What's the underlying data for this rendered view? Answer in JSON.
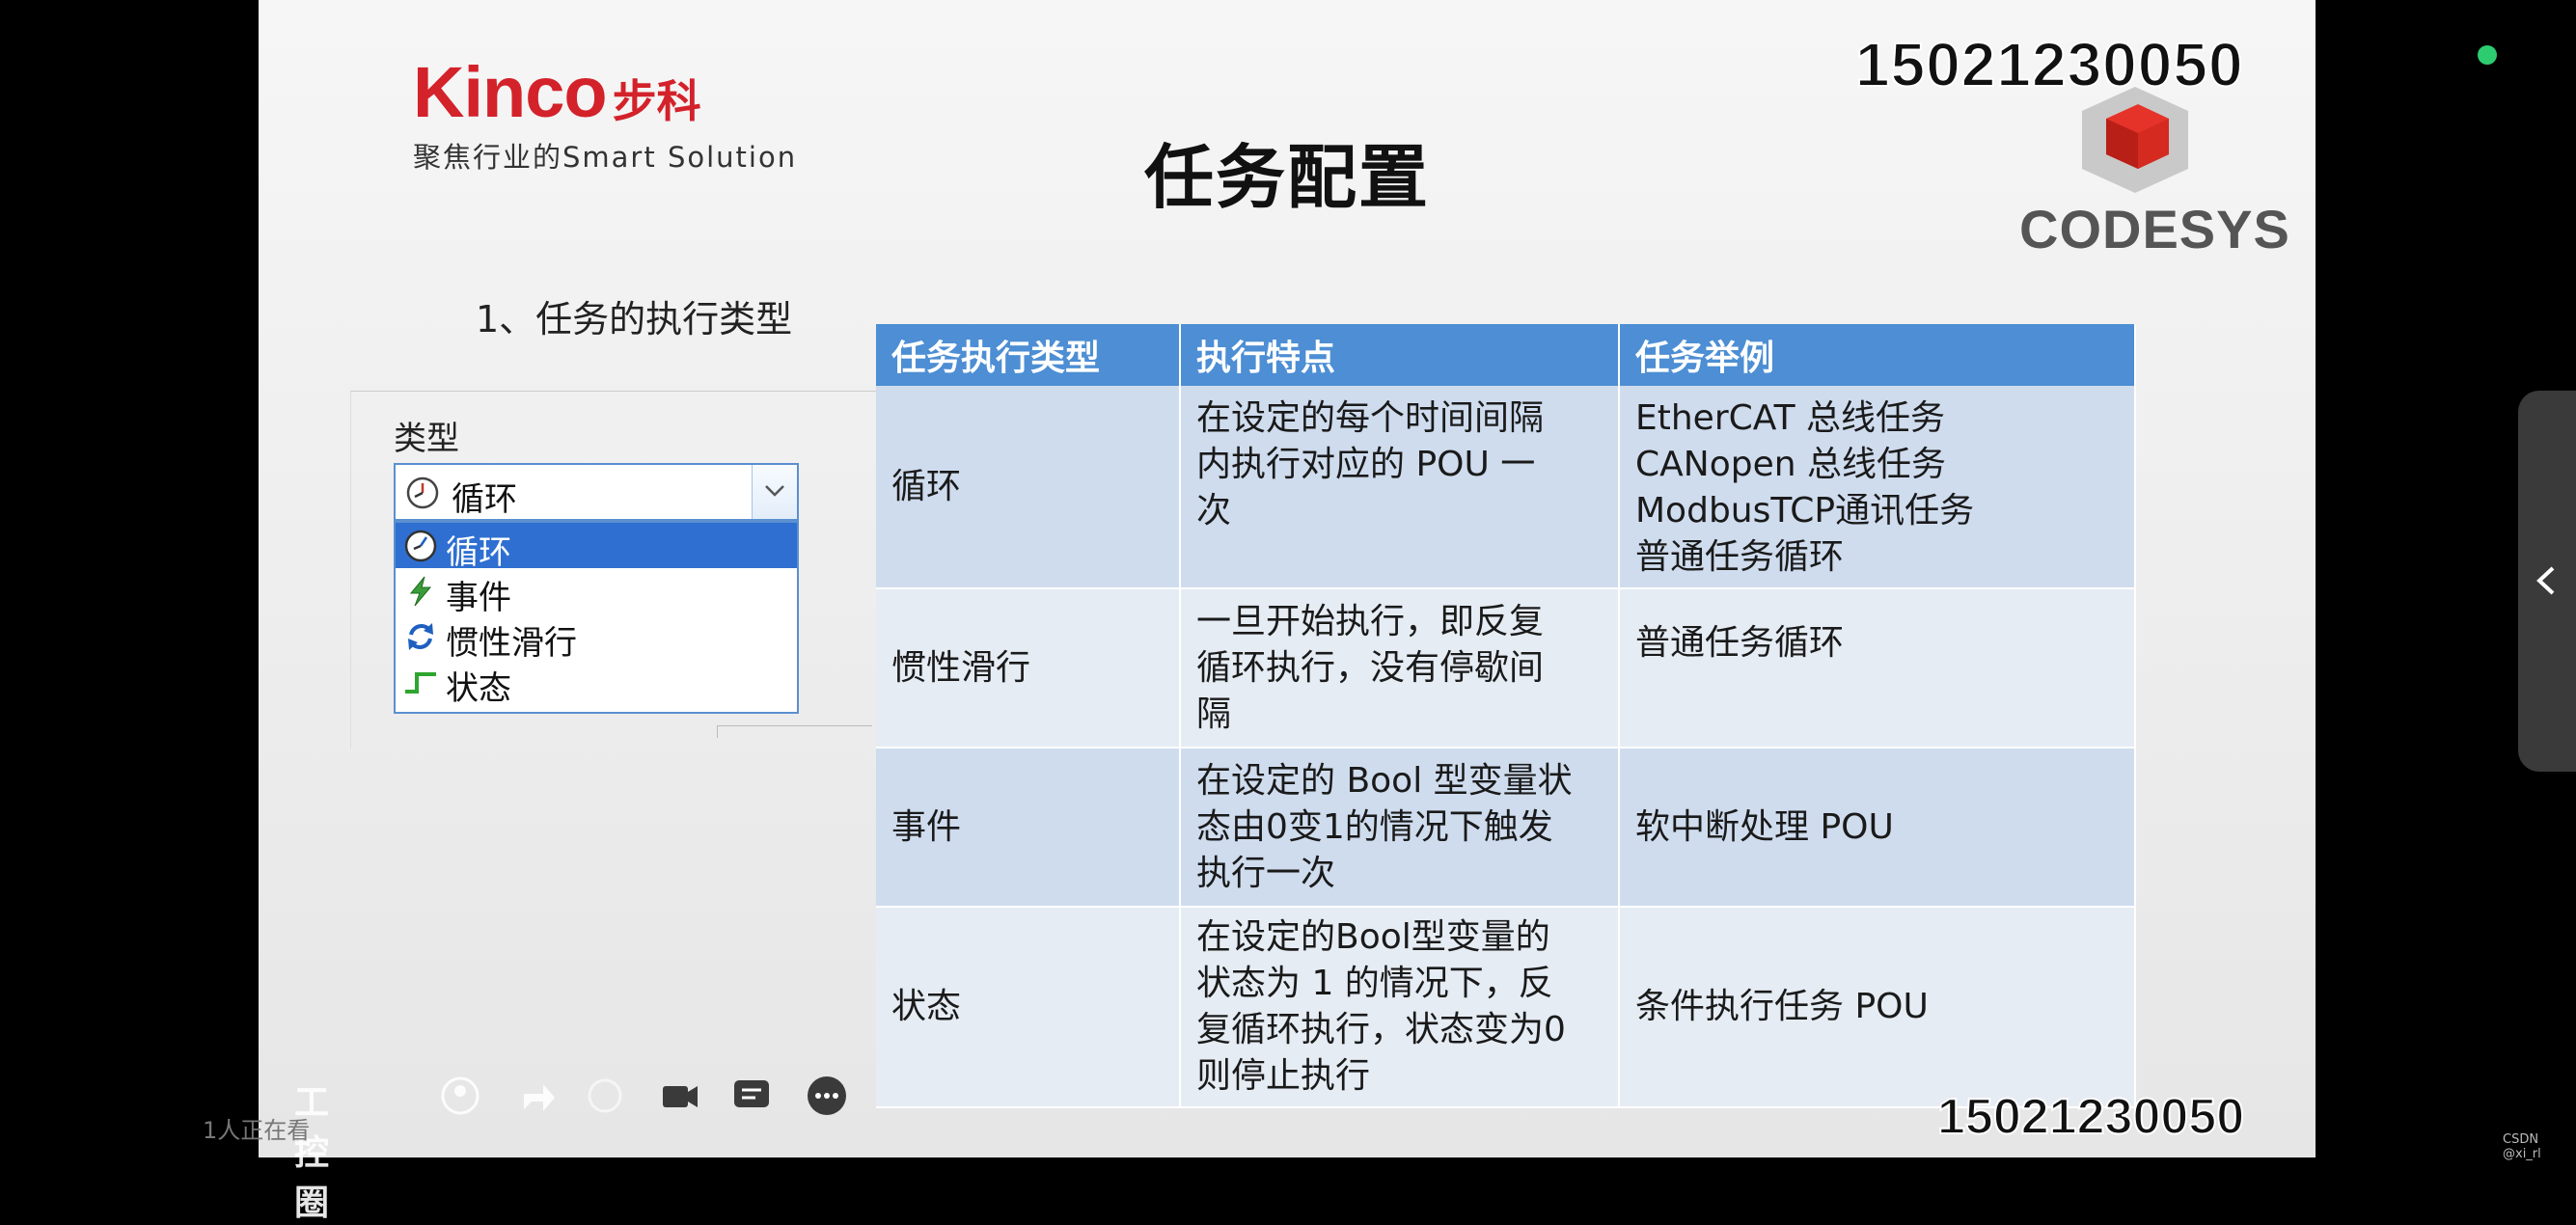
{
  "slide": {
    "logo": {
      "brand": "Kinco",
      "brand_cn": "步科",
      "tagline": "聚焦行业的Smart Solution"
    },
    "title": "任务配置",
    "phone_top": "15021230050",
    "phone_bottom": "15021230050",
    "codesys_logo": "CODESYS",
    "subtitle": "1、任务的执行类型"
  },
  "type_panel": {
    "label": "类型",
    "selected": "循环",
    "options": [
      {
        "label": "循环",
        "icon": "clock-icon",
        "selected": true
      },
      {
        "label": "事件",
        "icon": "lightning-icon",
        "selected": false
      },
      {
        "label": "惯性滑行",
        "icon": "cycle-arrows-icon",
        "selected": false
      },
      {
        "label": "状态",
        "icon": "step-signal-icon",
        "selected": false
      }
    ]
  },
  "table": {
    "headers": [
      "任务执行类型",
      "执行特点",
      "任务举例"
    ],
    "rows": [
      {
        "type": "循环",
        "feature": "在设定的每个时间间隔\n内执行对应的 POU 一\n次",
        "example": "EtherCAT 总线任务\nCANopen 总线任务\nModbusTCP通讯任务\n普通任务循环"
      },
      {
        "type": "惯性滑行",
        "feature": "一旦开始执行，即反复\n循环执行，没有停歇间\n隔",
        "example": "普通任务循环"
      },
      {
        "type": "事件",
        "feature": "在设定的 Bool 型变量状\n态由0变1的情况下触发\n执行一次",
        "example": "软中断处理 POU"
      },
      {
        "type": "状态",
        "feature": "在设定的Bool型变量的\n状态为 1 的情况下，反\n复循环执行，状态变为0\n则停止执行",
        "example": "条件执行任务 POU"
      }
    ]
  },
  "player": {
    "brand": "工控圈",
    "viewers": "1人正在看"
  },
  "watermark": "CSDN @xi_rl",
  "colors": {
    "header_blue": "#4d8ed4",
    "row_odd": "#cfdcee",
    "row_even": "#e6ecf4",
    "kinco_red": "#d3222a",
    "select_blue": "#2f6fd1"
  }
}
